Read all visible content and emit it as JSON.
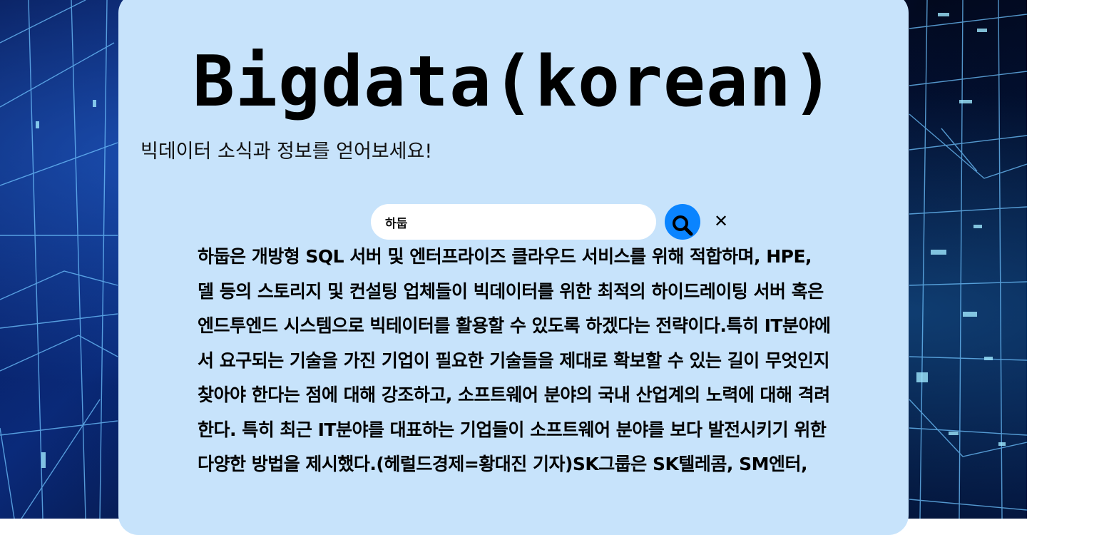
{
  "page": {
    "title": "Bigdata(korean)",
    "subtitle": "빅데이터 소식과 정보를 얻어보세요!"
  },
  "search": {
    "value": "하둡",
    "submit_icon": "search-icon",
    "clear_label": "✕"
  },
  "result": {
    "text": "하둡은 개방형 SQL 서버 및 엔터프라이즈 클라우드 서비스를 위해 적합하며, HPE, 델 등의 스토리지 및 컨설팅 업체들이 빅데이터를 위한 최적의 하이드레이팅 서버 혹은 엔드투엔드 시스템으로 빅테이터를 활용할 수 있도록 하겠다는 전략이다.특히 IT분야에서 요구되는 기술을 가진 기업이 필요한 기술들을 제대로 확보할 수 있는 길이 무엇인지 찾아야 한다는 점에 대해 강조하고, 소프트웨어 분야의 국내 산업계의 노력에 대해 격려한다. 특히 최근 IT분야를 대표하는 기업들이 소프트웨어 분야를 보다 발전시키기 위한 다양한 방법을 제시했다.(헤럴드경제=황대진 기자)SK그룹은 SK텔레콤, SM엔터,"
  },
  "colors": {
    "card_background": "#c7e3fb",
    "search_button": "#0a84ff",
    "text": "#000000"
  }
}
